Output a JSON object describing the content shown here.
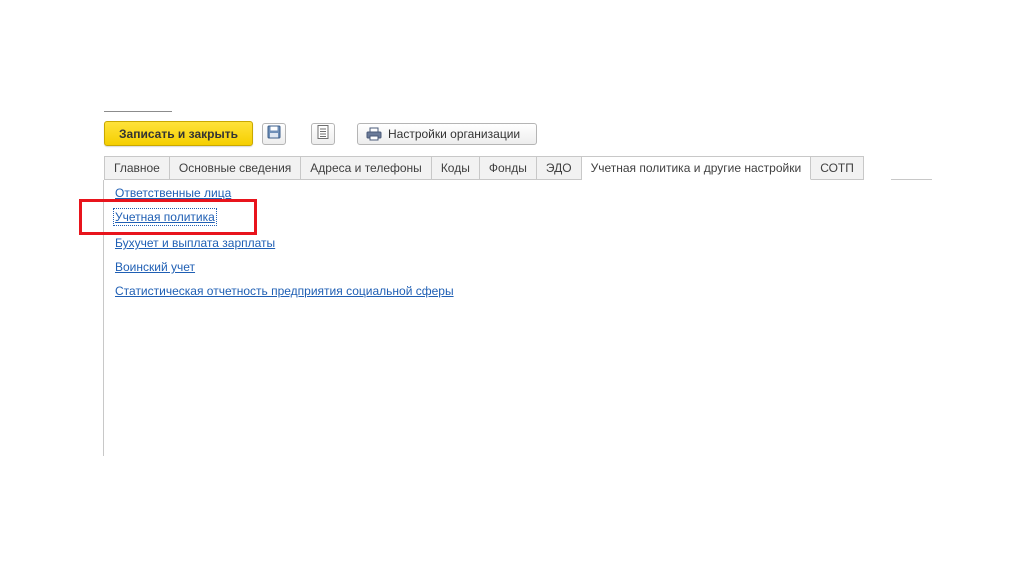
{
  "toolbar": {
    "save_close_label": "Записать и закрыть",
    "save_icon": "floppy-disk-icon",
    "report_icon": "document-list-icon",
    "org_settings_label": "Настройки организации",
    "org_settings_icon": "printer-icon"
  },
  "tabs": [
    {
      "label": "Главное",
      "active": false
    },
    {
      "label": "Основные сведения",
      "active": false
    },
    {
      "label": "Адреса и телефоны",
      "active": false
    },
    {
      "label": "Коды",
      "active": false
    },
    {
      "label": "Фонды",
      "active": false
    },
    {
      "label": "ЭДО",
      "active": false
    },
    {
      "label": "Учетная политика и другие настройки",
      "active": true
    },
    {
      "label": "СОТП",
      "active": false
    }
  ],
  "links": [
    {
      "label": "Ответственные лица"
    },
    {
      "label": "Учетная политика"
    },
    {
      "label": "Бухучет и выплата зарплаты"
    },
    {
      "label": "Воинский учет"
    },
    {
      "label": "Статистическая отчетность предприятия социальной сферы"
    }
  ],
  "colors": {
    "primary_button": "#f5cf00",
    "link": "#1f5fb4",
    "highlight": "#e8141c"
  }
}
